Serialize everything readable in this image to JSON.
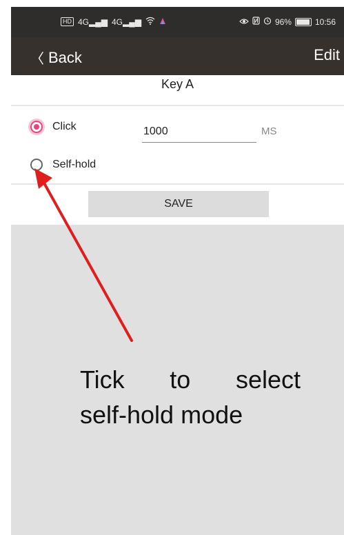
{
  "status_bar": {
    "left_icons": [
      "hd-icon",
      "signal-icon",
      "signal-icon",
      "wifi-icon",
      "app-icon"
    ],
    "hd_text": "HD",
    "signal1_text": "4G",
    "signal2_text": "4G",
    "battery_percent": "96%",
    "battery_level": 0.96,
    "time": "10:56"
  },
  "nav": {
    "back_label": "Back",
    "edit_label": "Edit"
  },
  "page": {
    "title": "Key A"
  },
  "options": {
    "click": {
      "label": "Click",
      "selected": true
    },
    "self_hold": {
      "label": "Self-hold",
      "selected": false
    }
  },
  "duration": {
    "value": "1000",
    "unit": "MS"
  },
  "save": {
    "label": "SAVE"
  },
  "annotation": {
    "line1": "Tick to select",
    "line2": "self-hold mode",
    "arrow_color": "#e01e1e"
  },
  "colors": {
    "accent": "#e4467c",
    "nav_bg": "#37312e",
    "content_bg": "#e0e0e0"
  }
}
